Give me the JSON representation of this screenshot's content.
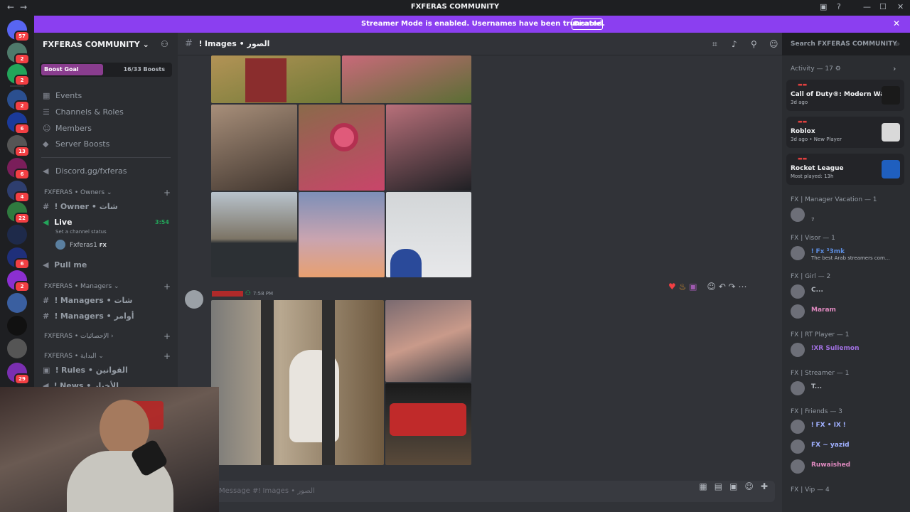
{
  "window": {
    "title": "FXFERAS COMMUNITY"
  },
  "banner": {
    "text": "Streamer Mode is enabled. Usernames have been truncated.",
    "button": "Disable"
  },
  "rail": {
    "servers": [
      {
        "badge": "57",
        "color": "#5865f2"
      },
      {
        "badge": "2",
        "color": "#4f7a6b"
      },
      {
        "badge": "2",
        "color": "#23a55a"
      },
      {
        "badge": "2",
        "color": "#2b4f8f"
      },
      {
        "badge": "6",
        "color": "#1b3a99"
      },
      {
        "badge": "13",
        "color": "#555"
      },
      {
        "badge": "6",
        "color": "#7a1e5a"
      },
      {
        "badge": "4",
        "color": "#2e3e6e"
      },
      {
        "badge": "22",
        "color": "#2f7a3f"
      },
      {
        "badge": "",
        "color": "#1e2a4a"
      },
      {
        "badge": "6",
        "color": "#1f2f7a"
      },
      {
        "badge": "2",
        "color": "#8b2fd0"
      },
      {
        "badge": "",
        "color": "#3a5fa0"
      },
      {
        "badge": "",
        "color": "#111"
      },
      {
        "badge": "",
        "color": "#555"
      },
      {
        "badge": "29",
        "color": "#7a2fb0"
      }
    ]
  },
  "sidebar": {
    "server_name": "FXFERAS COMMUNITY",
    "boost": {
      "label": "Boost Goal",
      "count": "16/33 Boosts",
      "progress": 0.48
    },
    "items": [
      {
        "label": "Events",
        "icon": "calendar-icon"
      },
      {
        "label": "Channels & Roles",
        "icon": "list-icon"
      },
      {
        "label": "Members",
        "icon": "members-icon"
      },
      {
        "label": "Server Boosts",
        "icon": "boost-icon"
      },
      {
        "label": "Discord.gg/fxferas",
        "icon": "megaphone-icon"
      }
    ],
    "cat_owners": "FXFERAS • Owners",
    "owner_channel": "ǃ Owner • شات",
    "live_channel": "Live",
    "live_time": "3:54",
    "live_status": "Set a channel status",
    "live_user": "Fxferas1",
    "live_user_tag": "FX",
    "pull_me": "Pull me",
    "cat_managers": "FXFERAS • Managers",
    "managers_chat": "ǃ Managers • شات",
    "managers_orders": "ǃ Managers • أوامر",
    "cat_stats": "FXFERAS • الإحصائيات",
    "cat_start": "FXFERAS • البداية",
    "rules": "ǃ Rules • القوانين",
    "news": "ǃ News • الأخبار"
  },
  "channel": {
    "name": "ǃ Images • الصور"
  },
  "search": {
    "placeholder": "Search FXFERAS COMMUNITY"
  },
  "message": {
    "time": "7:58 PM"
  },
  "composer": {
    "placeholder": "Message #ǃ Images • الصور"
  },
  "members": {
    "activity_head": "Activity — 17",
    "activities": [
      {
        "game": "Call of Duty®: Modern Warf...",
        "sub": "3d ago",
        "logo_color": "#1a1a1a"
      },
      {
        "game": "Roblox",
        "sub": "3d ago  •  New Player",
        "logo_color": "#d9d9d9"
      },
      {
        "game": "Rocket League",
        "sub": "Most played: 13h",
        "logo_color": "#1f5fbf"
      }
    ],
    "roles": [
      {
        "title": "FX | Manager Vacation — 1",
        "members": [
          {
            "name": "",
            "status": "7",
            "color": "#b5bac1"
          }
        ]
      },
      {
        "title": "FX | Visor — 1",
        "members": [
          {
            "name": "ǃ Fx ³3mk",
            "status": "The best Arab streamers com...",
            "color": "#5c8de0"
          }
        ]
      },
      {
        "title": "FX | Girl — 2",
        "members": [
          {
            "name": "C...",
            "status": "",
            "color": "#b5bac1"
          },
          {
            "name": "Maram",
            "status": "",
            "color": "#e08ac0"
          }
        ]
      },
      {
        "title": "FX | RT Player — 1",
        "members": [
          {
            "name": "ǃXR Suliemon",
            "status": "",
            "color": "#a070e0"
          }
        ]
      },
      {
        "title": "FX | Streamer — 1",
        "members": [
          {
            "name": "T...",
            "status": "",
            "color": "#b5bac1"
          }
        ]
      },
      {
        "title": "FX | Friends — 3",
        "members": [
          {
            "name": "ǃ FX • IX ǃ",
            "status": "",
            "color": "#a0b0ff"
          },
          {
            "name": "FX ~ yazid",
            "status": "",
            "color": "#a0b0ff"
          },
          {
            "name": "Ruwaished",
            "status": "",
            "color": "#e08ac0"
          }
        ]
      }
    ],
    "vip_head": "FX | Vip — 4"
  }
}
